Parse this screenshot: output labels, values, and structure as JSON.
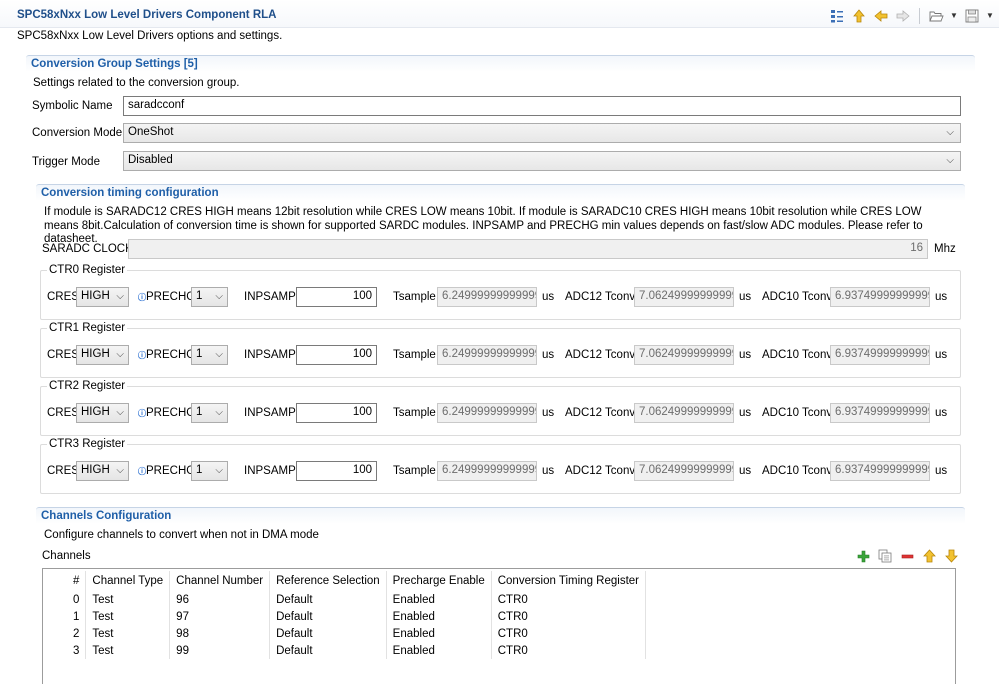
{
  "header": {
    "title": "SPC58xNxx Low Level Drivers Component RLA",
    "description": "SPC58xNxx Low Level Drivers options and settings."
  },
  "toolbar": {
    "icons": [
      "tree-icon",
      "arrow-up-icon",
      "arrow-left-icon",
      "arrow-right-icon",
      "folder-open-icon",
      "save-icon"
    ]
  },
  "conversion_group": {
    "title": "Conversion Group Settings [5]",
    "description": "Settings related to the conversion group.",
    "symbolic_name_label": "Symbolic Name",
    "symbolic_name_value": "saradcconf",
    "conversion_mode_label": "Conversion Mode",
    "conversion_mode_value": "OneShot",
    "trigger_mode_label": "Trigger Mode",
    "trigger_mode_value": "Disabled"
  },
  "timing": {
    "title": "Conversion timing configuration",
    "description": "If module is SARADC12 CRES HIGH means 12bit resolution while CRES LOW means  10bit. If module is SARADC10 CRES HIGH means 10bit resolution while CRES LOW means 8bit.Calculation of conversion time is shown for supported SARDC modules. INPSAMP and PRECHG  min values depends on fast/slow ADC modules. Please refer to datasheet.",
    "clock_label": "SARADC CLOCK",
    "clock_value": "16",
    "clock_unit": "Mhz",
    "labels": {
      "cres": "CRES",
      "prechg": "PRECHG",
      "inpsamp": "INPSAMP",
      "tsample": "Tsample",
      "adc12": "ADC12 Tconv",
      "adc10": "ADC10 Tconv",
      "us": "us"
    },
    "registers": [
      {
        "name": "CTR0 Register",
        "cres": "HIGH",
        "prechg": "1",
        "inpsamp": "100",
        "tsample": "6.249999999999999",
        "adc12": "7.062499999999999",
        "adc10": "6.937499999999999"
      },
      {
        "name": "CTR1 Register",
        "cres": "HIGH",
        "prechg": "1",
        "inpsamp": "100",
        "tsample": "6.249999999999999",
        "adc12": "7.062499999999999",
        "adc10": "6.937499999999999"
      },
      {
        "name": "CTR2 Register",
        "cres": "HIGH",
        "prechg": "1",
        "inpsamp": "100",
        "tsample": "6.249999999999999",
        "adc12": "7.062499999999999",
        "adc10": "6.937499999999999"
      },
      {
        "name": "CTR3 Register",
        "cres": "HIGH",
        "prechg": "1",
        "inpsamp": "100",
        "tsample": "6.249999999999999",
        "adc12": "7.062499999999999",
        "adc10": "6.937499999999999"
      }
    ]
  },
  "channels": {
    "title": "Channels Configuration",
    "description": "Configure channels to convert when not in DMA mode",
    "list_label": "Channels",
    "columns": [
      "#",
      "Channel Type",
      "Channel Number",
      "Reference Selection",
      "Precharge Enable",
      "Conversion Timing Register"
    ],
    "rows": [
      [
        "0",
        "Test",
        "96",
        "Default",
        "Enabled",
        "CTR0"
      ],
      [
        "1",
        "Test",
        "97",
        "Default",
        "Enabled",
        "CTR0"
      ],
      [
        "2",
        "Test",
        "98",
        "Default",
        "Enabled",
        "CTR0"
      ],
      [
        "3",
        "Test",
        "99",
        "Default",
        "Enabled",
        "CTR0"
      ]
    ]
  }
}
